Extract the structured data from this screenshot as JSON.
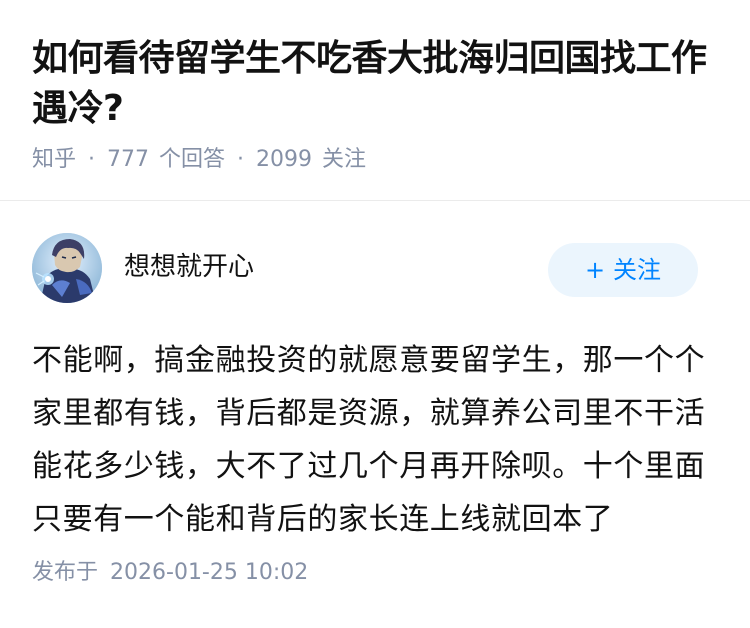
{
  "question": {
    "title": "如何看待留学生不吃香大批海归回国找工作遇冷?",
    "source": "知乎",
    "separator": "·",
    "answer_count": "777",
    "answer_label": "个回答",
    "follower_count": "2099",
    "follower_label": "关注"
  },
  "answer": {
    "author": {
      "name": "想想就开心",
      "avatar_icon": "anime-character-avatar"
    },
    "follow_button": {
      "icon": "+",
      "label": "关注"
    },
    "paragraphs": [
      "不能啊，搞金融投资的就愿意要留学生，那一个个家里都有钱，背后都是资源，就算养公司里不干活能花多少钱，大不了过几个月再开除呗。十个里面只要有一个能和背后的家长连上线就回本了"
    ],
    "publish": {
      "label": "发布于",
      "time": "2026-01-25 10:02"
    }
  },
  "colors": {
    "text": "#121212",
    "meta": "#8590a6",
    "brand": "#0084ff",
    "follow_bg": "#ebf5fd",
    "divider": "#ebebeb"
  }
}
